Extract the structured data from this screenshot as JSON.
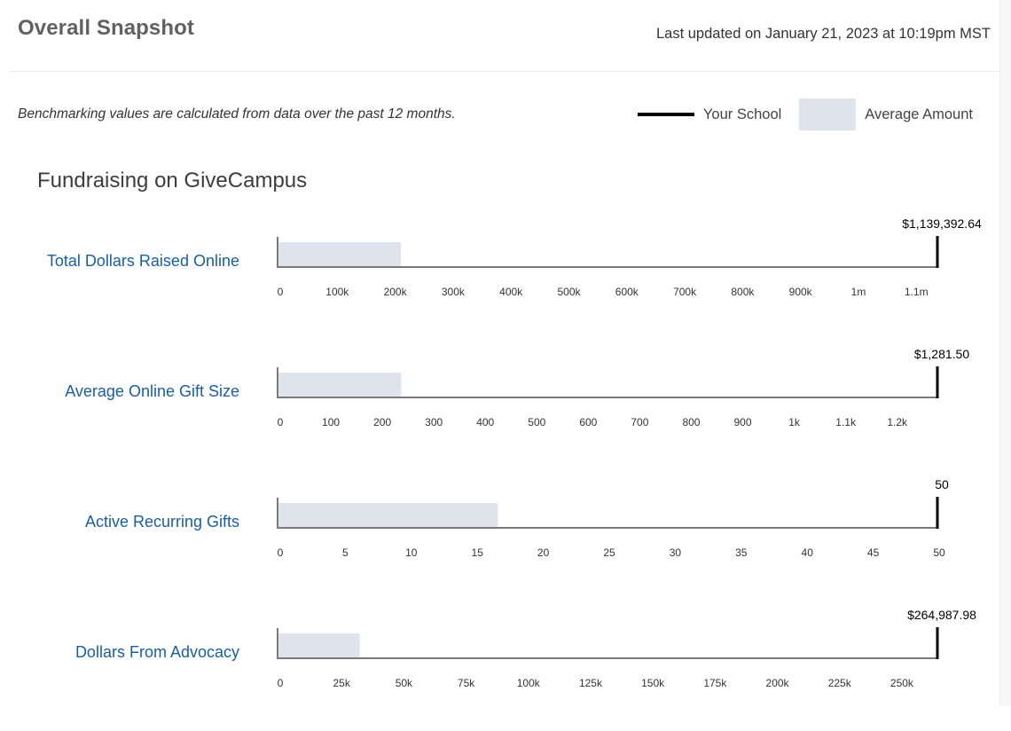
{
  "header": {
    "title": "Overall Snapshot",
    "last_updated": "Last updated on January 21, 2023 at 10:19pm MST"
  },
  "note": "Benchmarking values are calculated from data over the past 12 months.",
  "legend": {
    "your_school": "Your School",
    "average_amount": "Average Amount"
  },
  "section": {
    "title": "Fundraising on GiveCampus"
  },
  "colors": {
    "average_bar": "#dfe3ec",
    "your_school_line": "#000000",
    "axis": "#7a7a7a",
    "metric_label": "#1a5fa0"
  },
  "chart_data": [
    {
      "type": "bar",
      "title": "Total Dollars Raised Online",
      "your_school_value": 1139392.64,
      "your_school_label": "$1,139,392.64",
      "average_value": 213000,
      "xlim": [
        0,
        1139392.64
      ],
      "ticks": [
        0,
        100000,
        200000,
        300000,
        400000,
        500000,
        600000,
        700000,
        800000,
        900000,
        1000000,
        1100000
      ],
      "tick_labels": [
        "0",
        "100k",
        "200k",
        "300k",
        "400k",
        "500k",
        "600k",
        "700k",
        "800k",
        "900k",
        "1m",
        "1.1m"
      ]
    },
    {
      "type": "bar",
      "title": "Average Online Gift Size",
      "your_school_value": 1281.5,
      "your_school_label": "$1,281.50",
      "average_value": 240,
      "xlim": [
        0,
        1281.5
      ],
      "ticks": [
        0,
        100,
        200,
        300,
        400,
        500,
        600,
        700,
        800,
        900,
        1000,
        1100,
        1200
      ],
      "tick_labels": [
        "0",
        "100",
        "200",
        "300",
        "400",
        "500",
        "600",
        "700",
        "800",
        "900",
        "1k",
        "1.1k",
        "1.2k"
      ]
    },
    {
      "type": "bar",
      "title": "Active Recurring Gifts",
      "your_school_value": 50,
      "your_school_label": "50",
      "average_value": 16.7,
      "xlim": [
        0,
        50
      ],
      "ticks": [
        0,
        5,
        10,
        15,
        20,
        25,
        30,
        35,
        40,
        45,
        50
      ],
      "tick_labels": [
        "0",
        "5",
        "10",
        "15",
        "20",
        "25",
        "30",
        "35",
        "40",
        "45",
        "50"
      ]
    },
    {
      "type": "bar",
      "title": "Dollars From Advocacy",
      "your_school_value": 264987.98,
      "your_school_label": "$264,987.98",
      "average_value": 33000,
      "xlim": [
        0,
        264987.98
      ],
      "ticks": [
        0,
        25000,
        50000,
        75000,
        100000,
        125000,
        150000,
        175000,
        200000,
        225000,
        250000
      ],
      "tick_labels": [
        "0",
        "25k",
        "50k",
        "75k",
        "100k",
        "125k",
        "150k",
        "175k",
        "200k",
        "225k",
        "250k"
      ]
    }
  ]
}
